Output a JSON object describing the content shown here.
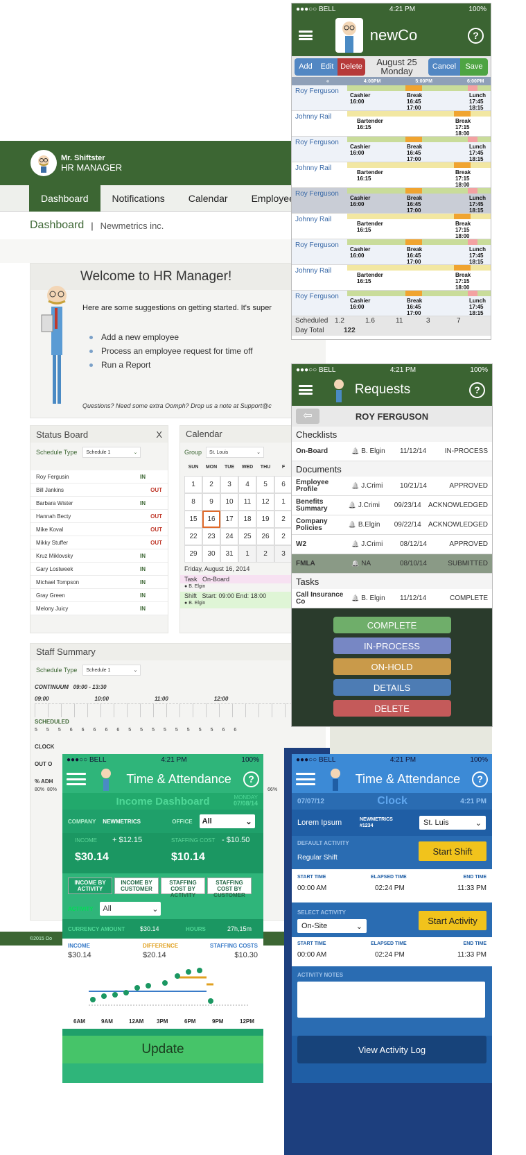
{
  "desktop": {
    "brand_line1": "Mr. Shiftster",
    "brand_line2": "HR MANAGER",
    "nav": [
      "Dashboard",
      "Notifications",
      "Calendar",
      "Employees"
    ],
    "page_title": "Dashboard",
    "company": "Newmetrics inc.",
    "welcome_title": "Welcome to HR Manager!",
    "welcome_text": "Here are some suggestions on getting started. It's super",
    "suggestions": [
      "Add a new employee",
      "Process an employee request for time off",
      "Run a Report"
    ],
    "support_note": "Questions? Need some extra Oomph? Drop us a note at Support@c",
    "status_board": {
      "title": "Status Board",
      "close": "X",
      "schedule_label": "Schedule Type",
      "schedule_value": "Schedule 1",
      "rows": [
        {
          "name": "Roy Fergusin",
          "status": "IN"
        },
        {
          "name": "Bill Jankins",
          "status": "OUT"
        },
        {
          "name": "Barbara Wister",
          "status": "IN"
        },
        {
          "name": "Hannah Becty",
          "status": "OUT"
        },
        {
          "name": "Mike Koval",
          "status": "OUT"
        },
        {
          "name": "Mikky Stuffer",
          "status": "OUT"
        },
        {
          "name": "Kruz Miklovsky",
          "status": "IN"
        },
        {
          "name": "Gary Lostweek",
          "status": "IN"
        },
        {
          "name": "Michael Tompson",
          "status": "IN"
        },
        {
          "name": "Gray Green",
          "status": "IN"
        },
        {
          "name": "Melony Juicy",
          "status": "IN"
        }
      ]
    },
    "calendar": {
      "title": "Calendar",
      "group_label": "Group",
      "group_value": "St. Louis",
      "days": [
        "SUN",
        "MON",
        "TUE",
        "WED",
        "THU",
        "F"
      ],
      "dates": [
        "1",
        "2",
        "3",
        "4",
        "5",
        "6",
        "8",
        "9",
        "10",
        "11",
        "12",
        "1",
        "15",
        "16",
        "17",
        "18",
        "19",
        "2",
        "22",
        "23",
        "24",
        "25",
        "26",
        "2",
        "29",
        "30",
        "31",
        "1",
        "2",
        "3"
      ],
      "selected_date": "Friday, August 16, 2014",
      "task_label": "Task",
      "task_value": "On-Board",
      "task_person": "B. Elgin",
      "shift_label": "Shift",
      "shift_value": "Start: 09:00   End: 18:00",
      "shift_person": "B. Elgin"
    },
    "staff_summary": {
      "title": "Staff Summary",
      "schedule_label": "Schedule Type",
      "schedule_value": "Schedule 1",
      "continuum": "CONTINUUM",
      "continuum_range": "09:00 - 13:30",
      "times": [
        "09:00",
        "10:00",
        "11:00",
        "12:00"
      ],
      "scheduled": "SCHEDULED",
      "scheduled_values": [
        "5",
        "5",
        "5",
        "6",
        "6",
        "6",
        "6",
        "6",
        "5",
        "5",
        "5",
        "5",
        "5",
        "5",
        "5",
        "5",
        "6",
        "6"
      ],
      "clock": "CLOCK",
      "out": "OUT O",
      "adh": "% ADH",
      "adh_values": [
        "80%",
        "80%"
      ],
      "adh_end": "66%"
    },
    "footer": "©2015 Oo",
    "footer_right": "ntacts"
  },
  "phone_schedule": {
    "status": {
      "carrier": "●●●○○ BELL",
      "time": "4:21 PM",
      "battery": "100%"
    },
    "title": "newCo",
    "buttons": {
      "add": "Add",
      "edit": "Edit",
      "delete": "Delete",
      "cancel": "Cancel",
      "save": "Save"
    },
    "date": "August 25",
    "day": "Monday",
    "times": [
      "4:00PM",
      "5:00PM",
      "6:00PM"
    ],
    "rows": [
      {
        "name": "Roy Ferguson",
        "blocks": [
          {
            "label": "Cashier",
            "t": "16:00"
          },
          {
            "label": "Break",
            "t": "16:45 17:00"
          },
          {
            "label": "Lunch",
            "t": "17:45 18:15"
          }
        ]
      },
      {
        "name": "Johnny Rail",
        "blocks": [
          {
            "label": "Bartender",
            "t": "16:15"
          },
          {
            "label": "Break",
            "t": "17:15 18:00"
          }
        ]
      },
      {
        "name": "Roy Ferguson",
        "blocks": [
          {
            "label": "Cashier",
            "t": "16:00"
          },
          {
            "label": "Break",
            "t": "16:45 17:00"
          },
          {
            "label": "Lunch",
            "t": "17:45 18:15"
          }
        ]
      },
      {
        "name": "Johnny Rail",
        "blocks": [
          {
            "label": "Bartender",
            "t": "16:15"
          },
          {
            "label": "Break",
            "t": "17:15 18:00"
          }
        ]
      },
      {
        "name": "Roy Ferguson",
        "blocks": [
          {
            "label": "Cashier",
            "t": "16:00"
          },
          {
            "label": "Break",
            "t": "16:45 17:00"
          },
          {
            "label": "Lunch",
            "t": "17:45 18:15"
          }
        ]
      },
      {
        "name": "Johnny Rail",
        "blocks": [
          {
            "label": "Bartender",
            "t": "16:15"
          },
          {
            "label": "Break",
            "t": "17:15 18:00"
          }
        ]
      },
      {
        "name": "Roy Ferguson",
        "blocks": [
          {
            "label": "Cashier",
            "t": "16:00"
          },
          {
            "label": "Break",
            "t": "16:45 17:00"
          },
          {
            "label": "Lunch",
            "t": "17:45 18:15"
          }
        ]
      },
      {
        "name": "Johnny Rail",
        "blocks": [
          {
            "label": "Bartender",
            "t": "16:15"
          },
          {
            "label": "Break",
            "t": "17:15 18:00"
          }
        ]
      },
      {
        "name": "Roy Ferguson",
        "blocks": [
          {
            "label": "Cashier",
            "t": "16:00"
          },
          {
            "label": "Break",
            "t": "16:45 17:00"
          },
          {
            "label": "Lunch",
            "t": "17:45 18:15"
          }
        ]
      }
    ],
    "scheduled_label": "Scheduled",
    "scheduled_values": [
      "1.2",
      "1.6",
      "11",
      "3",
      "7"
    ],
    "day_total_label": "Day Total",
    "day_total": "122"
  },
  "phone_requests": {
    "status": {
      "carrier": "●●●○○ BELL",
      "time": "4:21 PM",
      "battery": "100%"
    },
    "title": "Requests",
    "employee": "ROY FERGUSON",
    "checklists": "Checklists",
    "checklist_rows": [
      {
        "item": "On-Board",
        "person": "B. Elgin",
        "date": "11/12/14",
        "status": "IN-PROCESS"
      }
    ],
    "documents": "Documents",
    "document_rows": [
      {
        "item": "Employee Profile",
        "person": "J.Crimi",
        "date": "10/21/14",
        "status": "APPROVED"
      },
      {
        "item": "Benefits Summary",
        "person": "J.Crimi",
        "date": "09/23/14",
        "status": "ACKNOWLEDGED"
      },
      {
        "item": "Company Policies",
        "person": "B.Elgin",
        "date": "09/22/14",
        "status": "ACKNOWLEDGED"
      },
      {
        "item": "W2",
        "person": "J.Crimi",
        "date": "08/12/14",
        "status": "APPROVED"
      },
      {
        "item": "FMLA",
        "person": "NA",
        "date": "08/10/14",
        "status": "SUBMITTED"
      }
    ],
    "tasks": "Tasks",
    "task_rows": [
      {
        "item": "Call Insurance Co",
        "person": "B. Elgin",
        "date": "11/12/14",
        "status": "COMPLETE"
      }
    ],
    "actions": [
      "COMPLETE",
      "IN-PROCESS",
      "ON-HOLD",
      "DETAILS",
      "DELETE"
    ]
  },
  "phone_income": {
    "status": {
      "carrier": "●●●○○ BELL",
      "time": "4:21 PM",
      "battery": "100%"
    },
    "title": "Time & Attendance",
    "dashboard_title": "Income Dashboard",
    "day": "MONDAY",
    "date": "07/08/14",
    "company_label": "COMPANY",
    "company_value": "NEWMETRICS",
    "office_label": "OFFICE",
    "office_value": "All",
    "income_label": "INCOME",
    "income_delta": "+ $12.15",
    "income_value": "$30.14",
    "staffing_label": "STAFFING COST",
    "staffing_delta": "- $10.50",
    "staffing_value": "$10.14",
    "tabs": [
      "INCOME BY ACTIVITY",
      "INCOME BY CUSTOMER",
      "STAFFING COST BY ACTIVITY",
      "STAFFING COST BY CUSTOMER"
    ],
    "activity_label": "ACTIVITY",
    "activity_value": "All",
    "currency_label": "CURRENCY AMOUNT",
    "currency_value": "$30.14",
    "hours_label": "HOURS",
    "hours_value": "27h,15m",
    "sum_income_label": "INCOME",
    "sum_income": "$30.14",
    "difference_label": "DIFFERENCE",
    "difference": "$20.14",
    "sum_staffing_label": "STAFFING COSTS",
    "sum_staffing": "$10.30",
    "chart_labels": [
      "6AM",
      "9AM",
      "12AM",
      "3PM",
      "6PM",
      "9PM",
      "12PM"
    ],
    "update": "Update"
  },
  "phone_clock": {
    "status": {
      "carrier": "●●●○○ BELL",
      "time": "4:21 PM",
      "battery": "100%"
    },
    "title": "Time & Attendance",
    "date": "07/07/12",
    "heading": "Clock",
    "time": "4:21 PM",
    "name": "Lorem Ipsum",
    "company": "NEWMETRICS",
    "emp_id": "#1234",
    "location": "St. Luis",
    "default_activity_label": "DEFAULT ACTIVITY",
    "default_activity": "Regular Shift",
    "start_shift": "Start Shift",
    "start_time_label": "START TIME",
    "elapsed_label": "ELAPSED TIME",
    "end_time_label": "END TIME",
    "start_time": "00:00 AM",
    "elapsed": "02:24 PM",
    "end_time": "11:33 PM",
    "select_activity_label": "SELECT ACTIVITY",
    "select_activity": "On-Site",
    "start_activity": "Start Activity",
    "start_time2": "00:00 AM",
    "elapsed2": "02:24 PM",
    "end_time2": "11:33 PM",
    "notes_label": "ACTIVITY NOTES",
    "view_log": "View Activity Log"
  }
}
